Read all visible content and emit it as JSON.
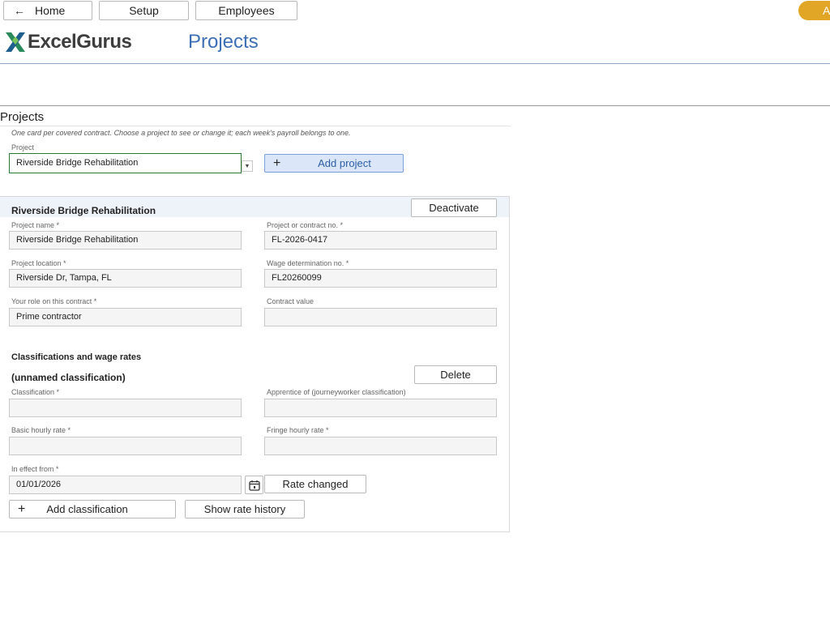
{
  "nav": {
    "home": "Home",
    "setup": "Setup",
    "employees": "Employees",
    "account_initial": "A",
    "accent_color": "#e2a626"
  },
  "brand": {
    "logo_text": "ExcelGurus",
    "page_title": "Projects"
  },
  "projects": {
    "section_title": "Projects",
    "hint": "One card per covered contract. Choose a project to see or change it; each week's payroll belongs to one.",
    "select_label": "Project",
    "selected_project": "Riverside Bridge Rehabilitation",
    "add_project_label": "Add project"
  },
  "card": {
    "title": "Riverside Bridge Rehabilitation",
    "deactivate_label": "Deactivate",
    "fields": {
      "project_name": {
        "label": "Project name *",
        "value": "Riverside Bridge Rehabilitation"
      },
      "contract_no": {
        "label": "Project or contract no. *",
        "value": "FL-2026-0417"
      },
      "location": {
        "label": "Project location *",
        "value": "Riverside Dr, Tampa, FL"
      },
      "wage_det": {
        "label": "Wage determination no. *",
        "value": "FL20260099"
      },
      "role": {
        "label": "Your role on this contract *",
        "value": "Prime contractor"
      },
      "contract_value": {
        "label": "Contract value",
        "value": ""
      }
    },
    "classifications": {
      "heading": "Classifications and wage rates",
      "item_title": "(unnamed classification)",
      "delete_label": "Delete",
      "classification": {
        "label": "Classification *",
        "value": ""
      },
      "apprentice_of": {
        "label": "Apprentice of (journeyworker classification)",
        "value": ""
      },
      "basic_rate": {
        "label": "Basic hourly rate *",
        "value": ""
      },
      "fringe_rate": {
        "label": "Fringe hourly rate *",
        "value": ""
      },
      "effective": {
        "label": "In effect from *",
        "value": "01/01/2026"
      },
      "rate_changed_label": "Rate changed",
      "add_classification_label": "Add classification",
      "show_history_label": "Show rate history"
    }
  }
}
